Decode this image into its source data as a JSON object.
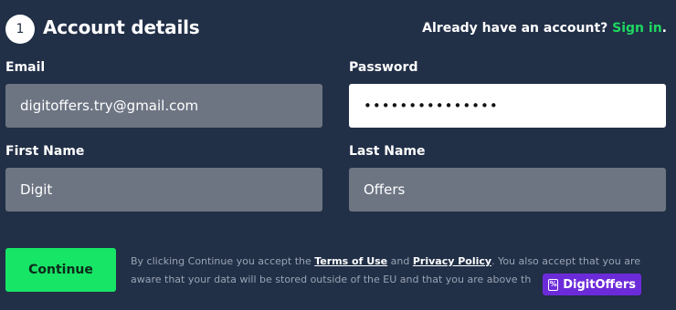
{
  "header": {
    "step_number": "1",
    "title": "Account details",
    "signin_prompt": "Already have an account?",
    "signin_link": "Sign in",
    "signin_suffix": "."
  },
  "form": {
    "email": {
      "label": "Email",
      "value": "digitoffers.try@gmail.com"
    },
    "password": {
      "label": "Password",
      "value": "•••••••••••••••"
    },
    "first_name": {
      "label": "First Name",
      "value": "Digit"
    },
    "last_name": {
      "label": "Last Name",
      "value": "Offers"
    }
  },
  "footer": {
    "continue_label": "Continue",
    "legal_prefix": "By clicking Continue you accept the ",
    "terms_link": "Terms of Use",
    "and_text": " and ",
    "privacy_link": "Privacy Policy",
    "legal_suffix": ". You also accept that you are aware that your data will be stored outside of the EU and that you are above th"
  },
  "watermark": {
    "icon": "percent-tag-icon",
    "text": "DigitOffers"
  },
  "colors": {
    "background": "#212f47",
    "accent": "#1ed760",
    "input_grey": "#6d7583",
    "watermark": "#6c2bd9"
  }
}
